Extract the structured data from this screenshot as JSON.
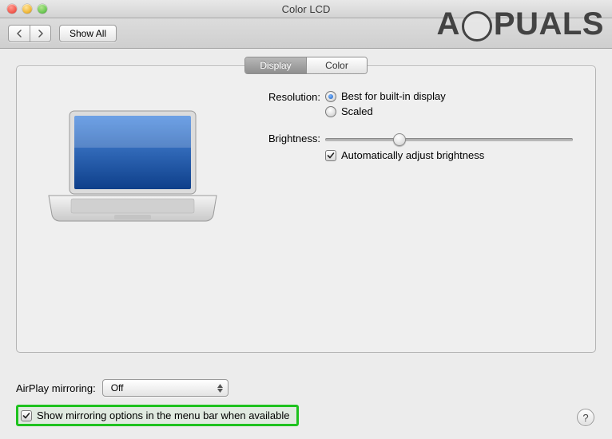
{
  "window": {
    "title": "Color LCD"
  },
  "toolbar": {
    "showAll": "Show All"
  },
  "tabs": {
    "display": "Display",
    "color": "Color",
    "active": "Display"
  },
  "settings": {
    "resolutionLabel": "Resolution:",
    "resBest": "Best for built-in display",
    "resScaled": "Scaled",
    "brightnessLabel": "Brightness:",
    "brightnessPct": 30,
    "autoBrightness": "Automatically adjust brightness"
  },
  "airplay": {
    "label": "AirPlay mirroring:",
    "selected": "Off"
  },
  "mirroringCheckbox": "Show mirroring options in the menu bar when available",
  "help": "?",
  "watermark": {
    "left": "A",
    "right": "PUALS"
  }
}
